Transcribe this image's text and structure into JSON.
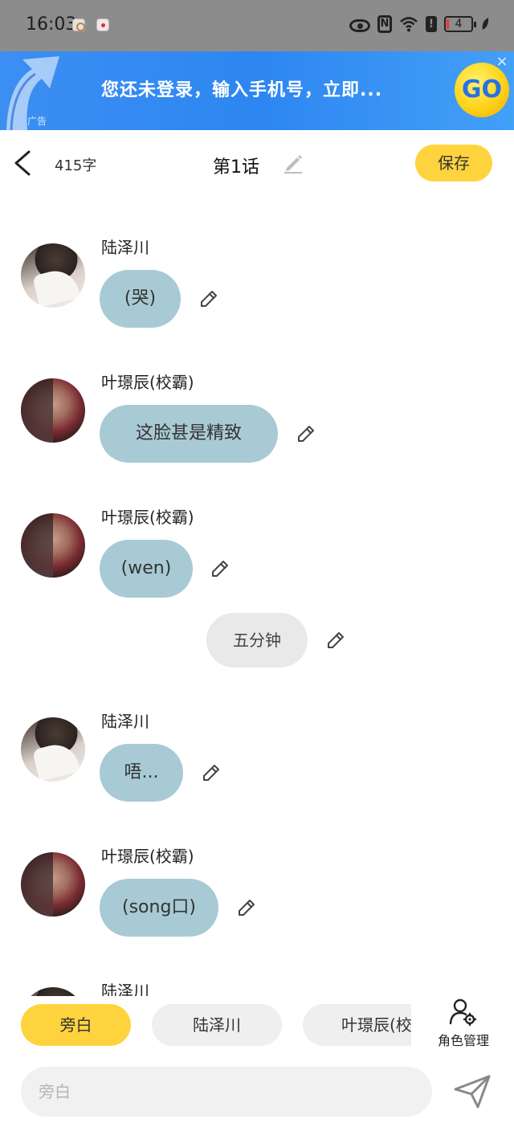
{
  "status_bar": {
    "time": "16:03",
    "battery": "4"
  },
  "ad": {
    "text": "您还未登录，输入手机号，立即...",
    "tag": "广告",
    "go_label": "GO",
    "close_label": "×"
  },
  "header": {
    "word_count": "415字",
    "chapter_title": "第1话",
    "save_label": "保存"
  },
  "messages": [
    {
      "type": "dialog",
      "speaker": "陆泽川",
      "avatar": "lu",
      "text": "(哭)"
    },
    {
      "type": "dialog",
      "speaker": "叶璟辰(校霸)",
      "avatar": "ye",
      "text": "这脸甚是精致"
    },
    {
      "type": "dialog",
      "speaker": "叶璟辰(校霸)",
      "avatar": "ye",
      "text": "(wen)"
    },
    {
      "type": "narration",
      "text": "五分钟"
    },
    {
      "type": "dialog",
      "speaker": "陆泽川",
      "avatar": "lu",
      "text": "唔..."
    },
    {
      "type": "dialog",
      "speaker": "叶璟辰(校霸)",
      "avatar": "ye",
      "text": "(song口)"
    },
    {
      "type": "dialog",
      "speaker": "陆泽川",
      "avatar": "lu",
      "text": ""
    }
  ],
  "roles": {
    "chips": [
      "旁白",
      "陆泽川",
      "叶璟辰(校"
    ],
    "selected": "旁白",
    "manage_label": "角色管理"
  },
  "composer": {
    "placeholder": "旁白"
  },
  "colors": {
    "accent_yellow": "#ffd33d",
    "bubble_blue": "#a8cad5",
    "narration_gray": "#e9e9e9",
    "ad_blue": "#2d86f1"
  },
  "icons": [
    "back-arrow-icon",
    "pencil-edit-icon",
    "send-icon",
    "role-settings-icon",
    "eye-icon",
    "nfc-icon",
    "wifi-icon",
    "battery-icon"
  ]
}
